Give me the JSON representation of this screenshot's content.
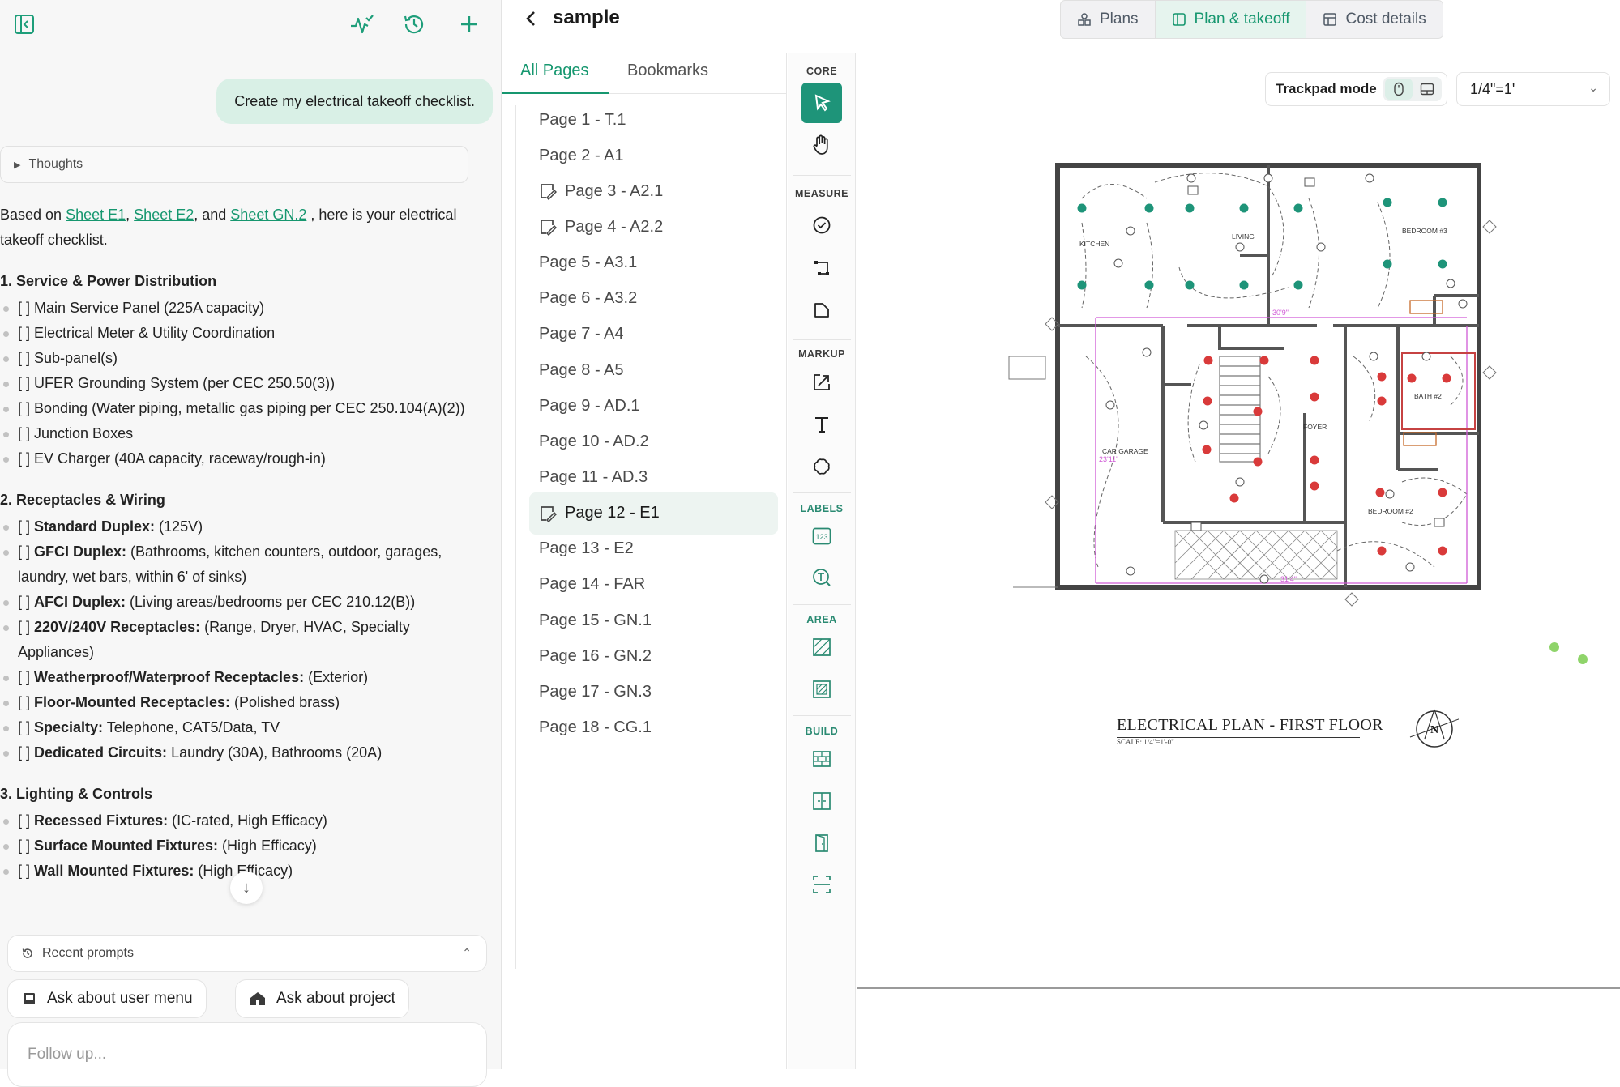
{
  "left_panel": {
    "user_message": "Create my electrical takeoff checklist.",
    "thoughts_label": "Thoughts",
    "intro": {
      "before": "Based on",
      "sheet_1": "Sheet E1",
      "sep_1": ",",
      "sheet_2": "Sheet E2",
      "sep_2": ", and",
      "sheet_3": "Sheet GN.2",
      "after": ", here is your electrical takeoff checklist."
    },
    "sections": [
      {
        "heading": "1. Service & Power Distribution",
        "items": [
          {
            "text": "[ ] Main Service Panel (225A capacity)"
          },
          {
            "text": "[ ] Electrical Meter & Utility Coordination"
          },
          {
            "text": "[ ] Sub-panel(s)"
          },
          {
            "text": "[ ] UFER Grounding System (per CEC 250.50(3))"
          },
          {
            "text": "[ ] Bonding (Water piping, metallic gas piping per CEC 250.104(A)(2))"
          },
          {
            "text": "[ ] Junction Boxes"
          },
          {
            "text": "[ ] EV Charger (40A capacity, raceway/rough-in)"
          }
        ]
      },
      {
        "heading": "2. Receptacles & Wiring",
        "items": [
          {
            "prefix": "[ ] ",
            "bold": "Standard Duplex:",
            "rest": " (125V)"
          },
          {
            "prefix": "[ ] ",
            "bold": "GFCI Duplex:",
            "rest": " (Bathrooms, kitchen counters, outdoor, garages, laundry, wet bars, within 6' of sinks)"
          },
          {
            "prefix": "[ ] ",
            "bold": "AFCI Duplex:",
            "rest": " (Living areas/bedrooms per CEC 210.12(B))"
          },
          {
            "prefix": "[ ] ",
            "bold": "220V/240V Receptacles:",
            "rest": " (Range, Dryer, HVAC, Specialty Appliances)"
          },
          {
            "prefix": "[ ] ",
            "bold": "Weatherproof/Waterproof Receptacles:",
            "rest": " (Exterior)"
          },
          {
            "prefix": "[ ] ",
            "bold": "Floor-Mounted Receptacles:",
            "rest": " (Polished brass)"
          },
          {
            "prefix": "[ ] ",
            "bold": "Specialty:",
            "rest": " Telephone, CAT5/Data, TV"
          },
          {
            "prefix": "[ ] ",
            "bold": "Dedicated Circuits:",
            "rest": " Laundry (30A), Bathrooms (20A)"
          }
        ]
      },
      {
        "heading": "3. Lighting & Controls",
        "items": [
          {
            "prefix": "[ ] ",
            "bold": "Recessed Fixtures:",
            "rest": " (IC-rated, High Efficacy)"
          },
          {
            "prefix": "[ ] ",
            "bold": "Surface Mounted Fixtures:",
            "rest": " (High Efficacy)"
          },
          {
            "prefix": "[ ] ",
            "bold": "Wall Mounted Fixtures:",
            "rest": " (High Efficacy)"
          }
        ]
      }
    ],
    "recent_prompts_label": "Recent prompts",
    "prompt_chips": [
      "Ask about user menu",
      "Ask about project"
    ],
    "follow_up_placeholder": "Follow up..."
  },
  "header": {
    "project_title": "sample",
    "view_tabs": [
      "Plans",
      "Plan & takeoff",
      "Cost details"
    ],
    "active_view_tab": "Plan & takeoff"
  },
  "pages_panel": {
    "tabs": [
      "All Pages",
      "Bookmarks"
    ],
    "active_tab": "All Pages",
    "pages": [
      {
        "label": "Page 1 - T.1",
        "bookmarked": false
      },
      {
        "label": "Page 2 - A1",
        "bookmarked": false
      },
      {
        "label": "Page 3 - A2.1",
        "bookmarked": true
      },
      {
        "label": "Page 4 - A2.2",
        "bookmarked": true
      },
      {
        "label": "Page 5 - A3.1",
        "bookmarked": false
      },
      {
        "label": "Page 6 - A3.2",
        "bookmarked": false
      },
      {
        "label": "Page 7 - A4",
        "bookmarked": false
      },
      {
        "label": "Page 8 - A5",
        "bookmarked": false
      },
      {
        "label": "Page 9 - AD.1",
        "bookmarked": false
      },
      {
        "label": "Page 10 - AD.2",
        "bookmarked": false
      },
      {
        "label": "Page 11 - AD.3",
        "bookmarked": false
      },
      {
        "label": "Page 12 - E1",
        "bookmarked": true,
        "active": true
      },
      {
        "label": "Page 13 - E2",
        "bookmarked": false
      },
      {
        "label": "Page 14 - FAR",
        "bookmarked": false
      },
      {
        "label": "Page 15 - GN.1",
        "bookmarked": false
      },
      {
        "label": "Page 16 - GN.2",
        "bookmarked": false
      },
      {
        "label": "Page 17 - GN.3",
        "bookmarked": false
      },
      {
        "label": "Page 18 - CG.1",
        "bookmarked": false
      }
    ]
  },
  "toolbar": {
    "sections": {
      "core": "CORE",
      "measure": "MEASURE",
      "markup": "MARKUP",
      "labels": "LABELS",
      "area": "AREA",
      "build": "BUILD"
    },
    "active_tool": "select-icon"
  },
  "canvas": {
    "trackpad_label": "Trackpad mode",
    "scale_value": "1/4\"=1'",
    "plan_title": "ELECTRICAL PLAN - FIRST FLOOR",
    "plan_scale": "SCALE: 1/4\"=1'-0\"",
    "north_label": "N",
    "room_labels": [
      "LIVING",
      "BEDROOM #3",
      "KITCHEN",
      "CAR GARAGE",
      "FOYER",
      "BATH #2",
      "BEDROOM #2"
    ],
    "dimension_labels": [
      "30'9\"",
      "23'11\"",
      "31'4\""
    ]
  },
  "colors": {
    "accent": "#1e9479",
    "accent_text": "#16976f",
    "user_bubble": "#d9f0e6",
    "fixture_teal": "#1e9479",
    "fixture_red": "#d93a3a",
    "dimension_magenta": "#d05ad6"
  }
}
